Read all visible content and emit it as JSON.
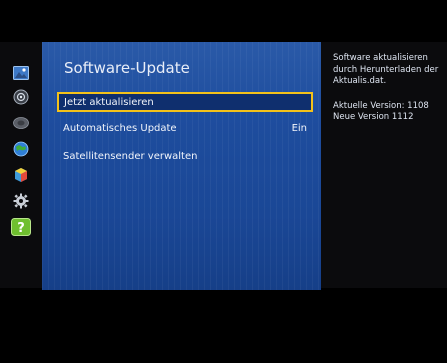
{
  "panel": {
    "title": "Software-Update",
    "items": [
      {
        "label": "Jetzt aktualisieren",
        "value": "",
        "selected": true
      },
      {
        "label": "Automatisches Update",
        "value": "Ein",
        "selected": false
      },
      {
        "label": "Satellitensender verwalten",
        "value": "",
        "selected": false
      }
    ]
  },
  "info": {
    "lines": [
      "Software aktualisieren",
      "durch Herunterladen der",
      "Aktualis.dat."
    ],
    "version_current": "Aktuelle Version: 1108",
    "version_new": "Neue Version 1112"
  },
  "sidebar": {
    "icons": [
      "picture-icon",
      "sound-icon",
      "broadcast-icon",
      "network-icon",
      "system-icon",
      "settings-icon",
      "support-icon"
    ],
    "active": "support-icon"
  },
  "colors": {
    "panel": "#1e4d9e",
    "selection_border": "#f4c21a",
    "support_active": "#6fbf2f",
    "background": "#000000"
  }
}
